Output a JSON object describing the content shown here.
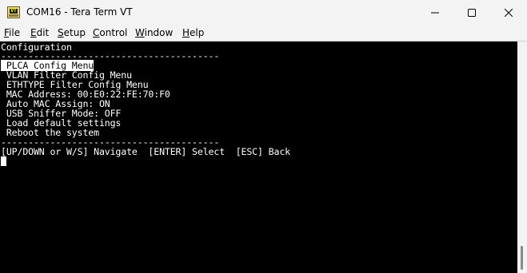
{
  "window": {
    "title": "COM16 - Tera Term VT",
    "icon_label": "VT",
    "controls": [
      "minimize-icon",
      "maximize-icon",
      "close-icon"
    ]
  },
  "menu": {
    "items": [
      {
        "first": "F",
        "rest": "ile"
      },
      {
        "first": "E",
        "rest": "dit"
      },
      {
        "first": "S",
        "rest": "etup"
      },
      {
        "first": "C",
        "rest": "ontrol"
      },
      {
        "first": "W",
        "rest": "indow"
      },
      {
        "first": "H",
        "rest": "elp"
      }
    ]
  },
  "terminal": {
    "heading": "Configuration",
    "separator_top": "----------------------------------------",
    "selected_item": " PLCA Config Menu",
    "items": [
      " VLAN Filter Config Menu",
      " ETHTYPE Filter Config Menu",
      " MAC Address: 00:E0:22:FE:70:F0",
      " Auto MAC Assign: ON",
      " USB Sniffer Mode: OFF",
      " Load default settings",
      " Reboot the system"
    ],
    "separator_bottom": "----------------------------------------",
    "help_line": "[UP/DOWN or W/S] Navigate  [ENTER] Select  [ESC] Back",
    "colors": {
      "background": "#000000",
      "text": "#ffffff",
      "highlight_bg": "#ffffff",
      "highlight_text": "#000000"
    }
  }
}
